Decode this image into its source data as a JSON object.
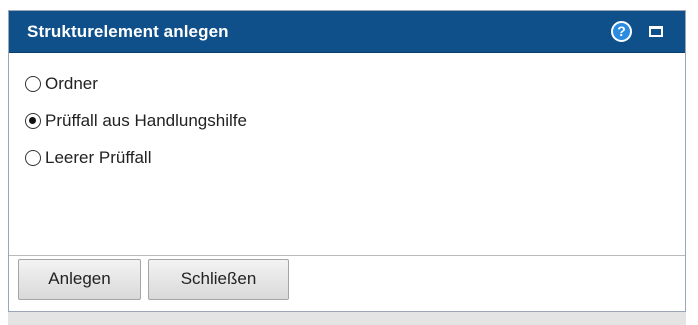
{
  "dialog": {
    "title": "Strukturelement anlegen",
    "help_glyph": "?",
    "icons": [
      "help-icon",
      "maximize-icon"
    ],
    "options": [
      {
        "label": "Ordner",
        "selected": false
      },
      {
        "label": "Prüffall aus Handlungshilfe",
        "selected": true
      },
      {
        "label": "Leerer Prüffall",
        "selected": false
      }
    ],
    "buttons": {
      "create_label": "Anlegen",
      "close_label": "Schließen"
    }
  },
  "colors": {
    "titlebar": "#0f4f8a",
    "help_icon": "#2b8be0"
  }
}
